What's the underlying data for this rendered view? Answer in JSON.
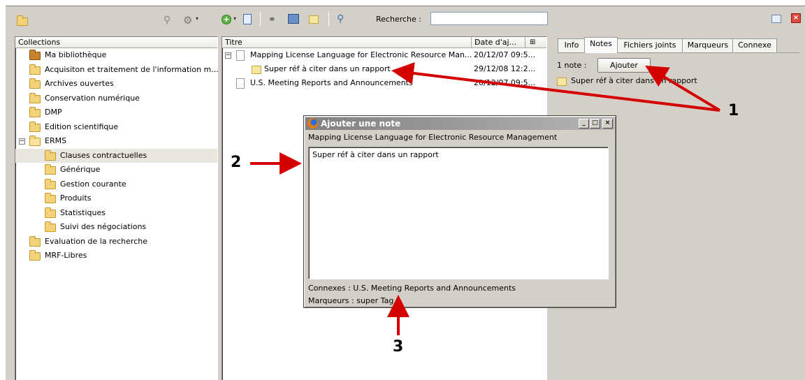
{
  "toolbar": {
    "search_label": "Recherche :",
    "search_value": ""
  },
  "collections": {
    "header": "Collections",
    "items": [
      {
        "label": "Ma bibliothèque"
      },
      {
        "label": "Acquisiton et traitement de l'information m..."
      },
      {
        "label": "Archives ouvertes"
      },
      {
        "label": "Conservation numérique"
      },
      {
        "label": "DMP"
      },
      {
        "label": "Edition scientifique"
      },
      {
        "label": "ERMS"
      },
      {
        "label": "Clauses contractuelles"
      },
      {
        "label": "Générique"
      },
      {
        "label": "Gestion courante"
      },
      {
        "label": "Produits"
      },
      {
        "label": "Statistiques"
      },
      {
        "label": "Suivi des négociations"
      },
      {
        "label": "Evaluation de la recherche"
      },
      {
        "label": "MRF-Libres"
      }
    ]
  },
  "items": {
    "col_title": "Titre",
    "col_date": "Date d'aj...",
    "rows": [
      {
        "title": "Mapping License Language for Electronic Resource Man...",
        "date": "20/12/07 09:5..."
      },
      {
        "title": "Super réf à citer dans un rapport",
        "date": "29/12/08 12:2..."
      },
      {
        "title": "U.S. Meeting Reports and Announcements",
        "date": "20/12/07 09:5..."
      }
    ]
  },
  "right_panel": {
    "tabs": [
      "Info",
      "Notes",
      "Fichiers joints",
      "Marqueurs",
      "Connexe"
    ],
    "note_count": "1 note :",
    "add_button": "Ajouter",
    "note_item": "Super réf à citer dans un rapport"
  },
  "dialog": {
    "title": "Ajouter une note",
    "subtitle": "Mapping License Language for Electronic Resource Management",
    "note_text": "Super réf à citer dans un rapport",
    "related": "Connexes : U.S. Meeting Reports and Announcements",
    "tags": "Marqueurs : super Tag"
  },
  "annotations": {
    "label_1": "1",
    "label_2": "2",
    "label_3": "3",
    "arrow_color": "#d40000"
  }
}
